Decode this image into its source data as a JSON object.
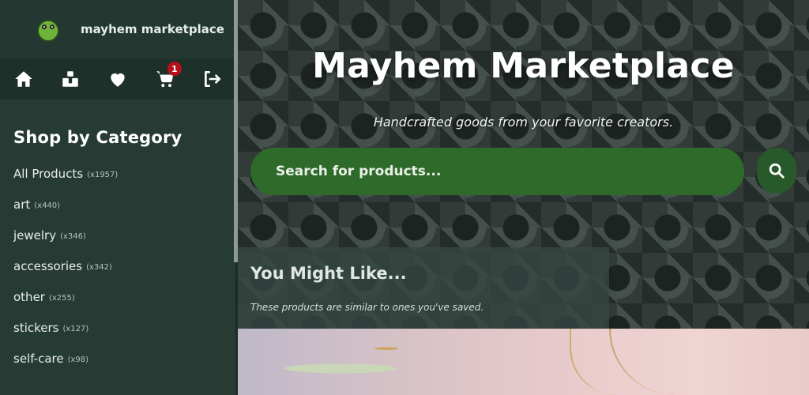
{
  "brand": {
    "name": "mayhem marketplace",
    "logo_icon": "goblin-mascot-icon"
  },
  "nav": {
    "items": [
      {
        "icon": "home-icon"
      },
      {
        "icon": "blocks-icon"
      },
      {
        "icon": "heart-icon"
      },
      {
        "icon": "cart-icon",
        "badge": "1"
      },
      {
        "icon": "logout-icon"
      }
    ]
  },
  "sidebar": {
    "title": "Shop by Category",
    "categories": [
      {
        "label": "All Products",
        "count": "(x1957)"
      },
      {
        "label": "art",
        "count": "(x440)"
      },
      {
        "label": "jewelry",
        "count": "(x346)"
      },
      {
        "label": "accessories",
        "count": "(x342)"
      },
      {
        "label": "other",
        "count": "(x255)"
      },
      {
        "label": "stickers",
        "count": "(x127)"
      },
      {
        "label": "self-care",
        "count": "(x98)"
      }
    ]
  },
  "hero": {
    "title": "Mayhem Marketplace",
    "subtitle": "Handcrafted goods from your favorite creators.",
    "search_placeholder": "Search for products...",
    "search_icon": "search-icon"
  },
  "recommendations": {
    "title": "You Might Like...",
    "subtitle": "These products are similar to ones you've saved."
  },
  "colors": {
    "sidebar_bg": "#263b34",
    "search_green": "#2e6b2a",
    "badge_red": "#b3121a"
  }
}
